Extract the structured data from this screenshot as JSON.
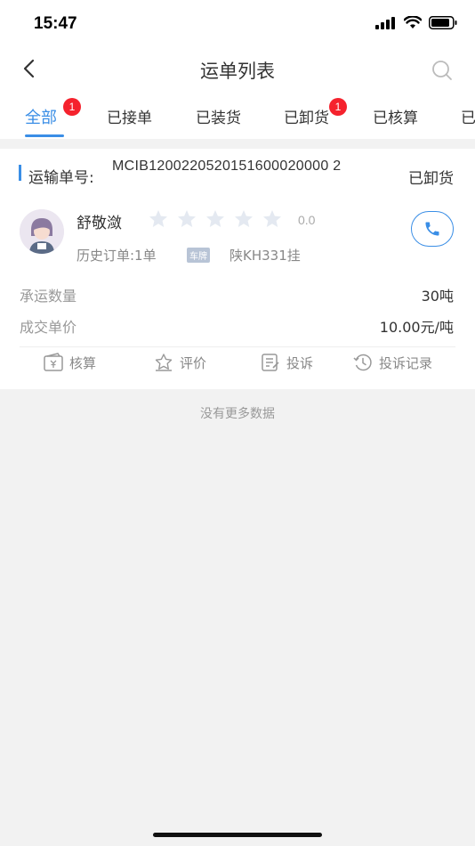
{
  "status_bar": {
    "time": "15:47"
  },
  "nav": {
    "title": "运单列表",
    "back_icon": "back-arrow-icon",
    "search_icon": "search-icon"
  },
  "tabs": [
    {
      "label": "全部",
      "active": true,
      "badge": "1"
    },
    {
      "label": "已接单",
      "active": false
    },
    {
      "label": "已装货",
      "active": false
    },
    {
      "label": "已卸货",
      "active": false,
      "badge": "1"
    },
    {
      "label": "已核算",
      "active": false
    },
    {
      "label": "已",
      "active": false
    }
  ],
  "order": {
    "number_label": "运输单号:",
    "number": "MCIB1200220520151600020000 2",
    "status": "已卸货",
    "driver_name": "舒敬潋",
    "rating": "0.0",
    "stars_filled": 0,
    "stars_total": 5,
    "history": "历史订单:1单",
    "plate_tag": "车牌",
    "plate": "陕KH331挂",
    "quantity_label": "承运数量",
    "quantity_value": "30吨",
    "price_label": "成交单价",
    "price_value": "10.00元/吨"
  },
  "actions": [
    {
      "label": "核算",
      "icon": "accounting-icon"
    },
    {
      "label": "评价",
      "icon": "review-icon"
    },
    {
      "label": "投诉",
      "icon": "complaint-icon"
    },
    {
      "label": "投诉记录",
      "icon": "complaint-history-icon"
    }
  ],
  "footer": {
    "no_more": "没有更多数据"
  },
  "colors": {
    "accent": "#3a8ee6",
    "badge": "#f5222d",
    "background": "#f2f2f2"
  }
}
